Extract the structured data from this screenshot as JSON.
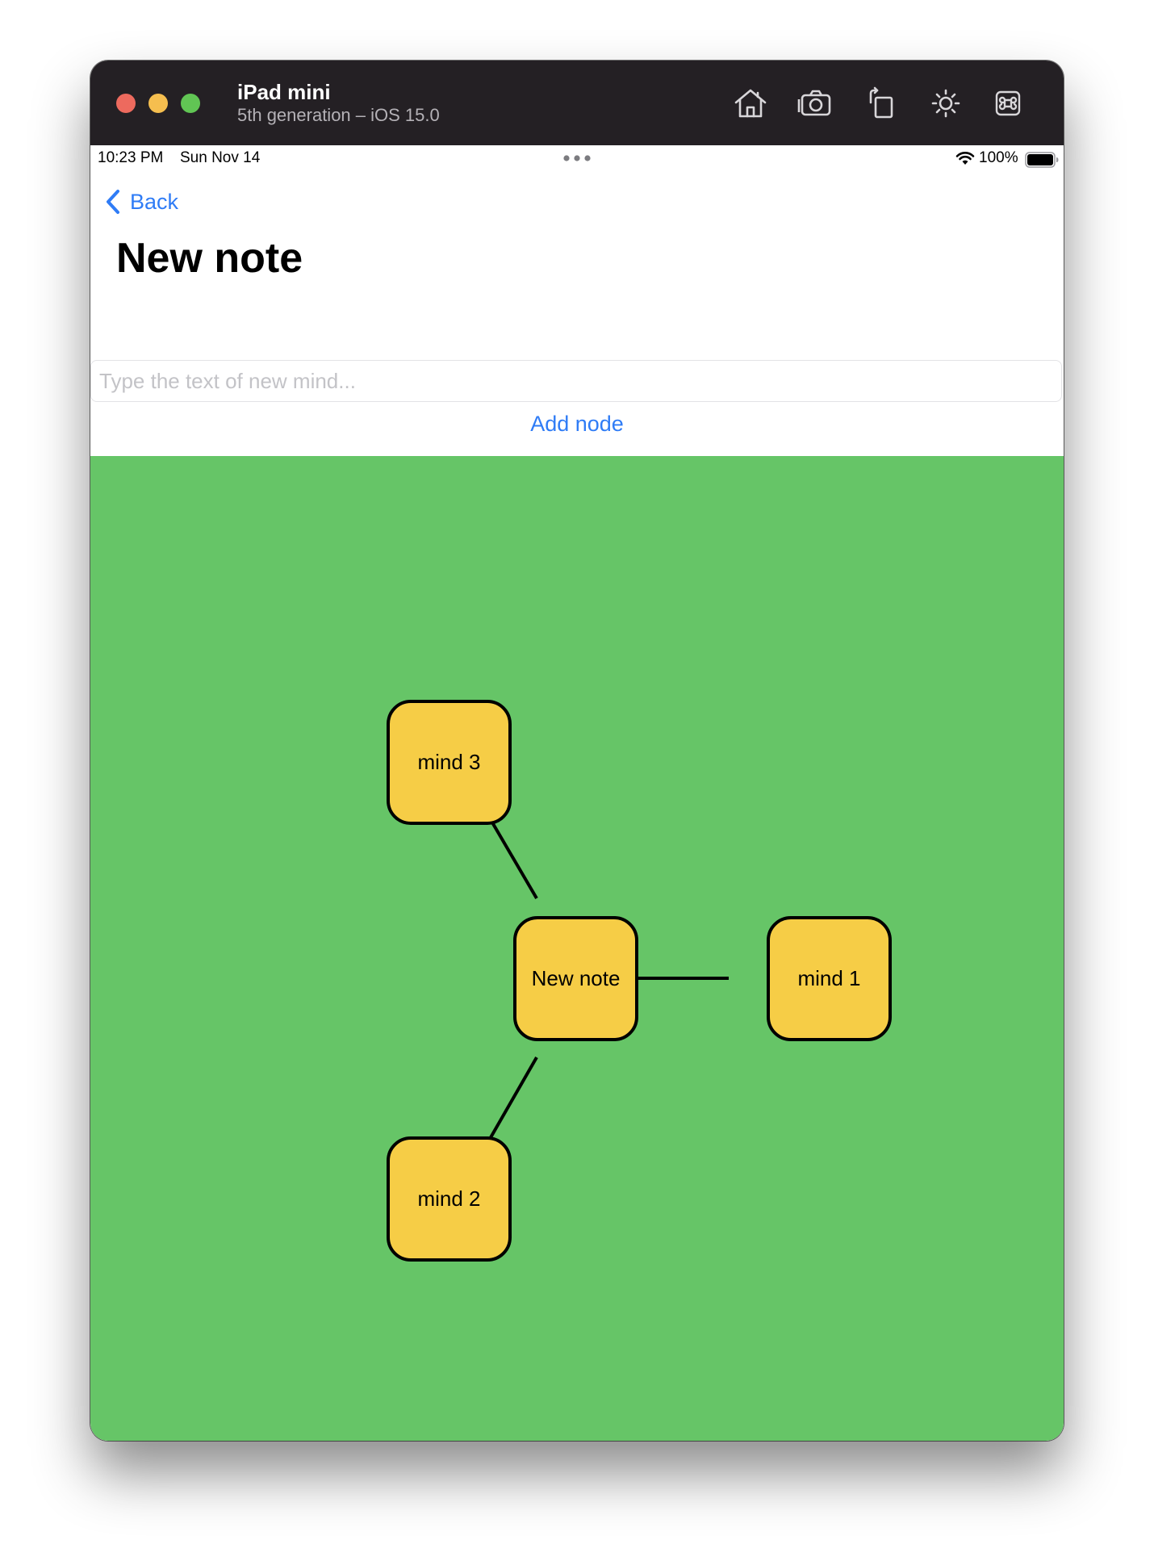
{
  "window": {
    "device_name": "iPad mini",
    "device_detail": "5th generation – iOS 15.0",
    "traffic_lights": {
      "close_color": "#ed6a5e",
      "minimize_color": "#f5be4f",
      "zoom_color": "#61c554"
    },
    "toolbar_icons": [
      "home-icon",
      "screenshot-icon",
      "rotate-icon",
      "appearance-icon",
      "command-icon"
    ]
  },
  "status_bar": {
    "time": "10:23 PM",
    "date": "Sun Nov 14",
    "battery_text": "100%"
  },
  "nav": {
    "back_label": "Back",
    "title": "New note"
  },
  "input": {
    "placeholder": "Type the text of new mind...",
    "value": ""
  },
  "add_button_label": "Add node",
  "canvas": {
    "background_color": "#66c567",
    "node_color": "#f6cd46"
  },
  "nodes": {
    "center": "New note",
    "mind1": "mind 1",
    "mind2": "mind 2",
    "mind3": "mind 3"
  },
  "colors": {
    "accent": "#2f7cf6",
    "titlebar": "#242024"
  }
}
